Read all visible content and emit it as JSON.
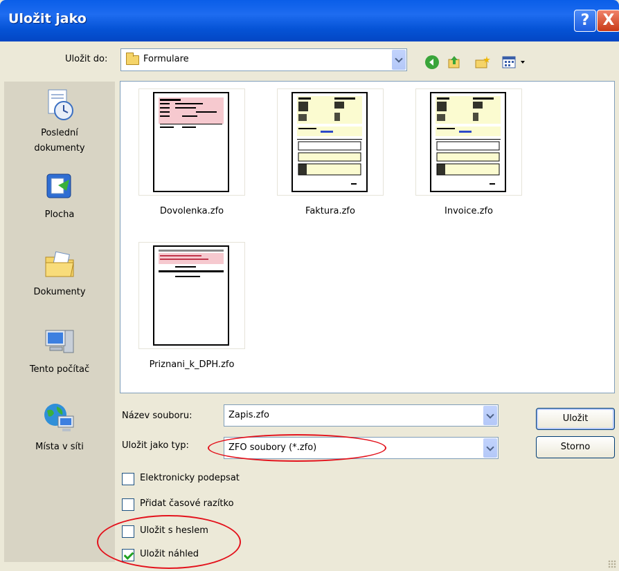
{
  "window": {
    "title": "Uložit jako",
    "help_glyph": "?",
    "close_glyph": "X"
  },
  "savein": {
    "label": "Uložit do:",
    "value": "Formulare"
  },
  "places": [
    {
      "label_1": "Poslední",
      "label_2": "dokumenty",
      "icon": "recent-documents-icon"
    },
    {
      "label_1": "Plocha",
      "icon": "desktop-icon"
    },
    {
      "label_1": "Dokumenty",
      "icon": "my-documents-icon"
    },
    {
      "label_1": "Tento počítač",
      "icon": "my-computer-icon"
    },
    {
      "label_1": "Místa v síti",
      "icon": "network-places-icon"
    }
  ],
  "files": [
    {
      "name": "Dovolenka.zfo"
    },
    {
      "name": "Faktura.zfo"
    },
    {
      "name": "Invoice.zfo"
    },
    {
      "name": "Priznani_k_DPH.zfo"
    }
  ],
  "filename": {
    "label": "Název souboru:",
    "value": "Zapis.zfo"
  },
  "filetype": {
    "label": "Uložit jako typ:",
    "value": "ZFO soubory (*.zfo)"
  },
  "buttons": {
    "save": "Uložit",
    "cancel": "Storno"
  },
  "options": [
    {
      "label": "Elektronicky podepsat",
      "checked": false
    },
    {
      "label": "Přidat časové razítko",
      "checked": false
    },
    {
      "label": "Uložit s heslem",
      "checked": false
    },
    {
      "label": "Uložit náhled",
      "checked": true
    }
  ],
  "colors": {
    "titlebar": "#0a5ee8",
    "annotation": "#e3121c",
    "places_bg": "#d8d4c4"
  }
}
